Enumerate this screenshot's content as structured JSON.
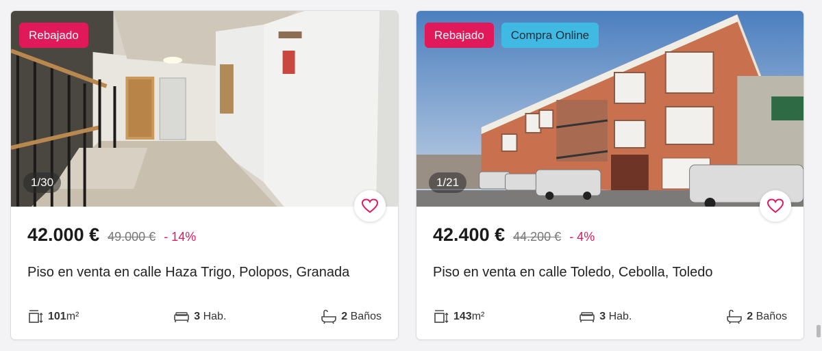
{
  "listings": [
    {
      "badges": [
        "Rebajado"
      ],
      "counter": "1/30",
      "price": "42.000 €",
      "old_price": "49.000 €",
      "discount": "- 14%",
      "title": "Piso en venta en calle Haza Trigo, Polopos, Granada",
      "area_value": "101",
      "area_unit": "m²",
      "rooms_value": "3",
      "rooms_unit": "Hab.",
      "baths_value": "2",
      "baths_unit": "Baños"
    },
    {
      "badges": [
        "Rebajado",
        "Compra Online"
      ],
      "counter": "1/21",
      "price": "42.400 €",
      "old_price": "44.200 €",
      "discount": "- 4%",
      "title": "Piso en venta en calle Toledo, Cebolla, Toledo",
      "area_value": "143",
      "area_unit": "m²",
      "rooms_value": "3",
      "rooms_unit": "Hab.",
      "baths_value": "2",
      "baths_unit": "Baños"
    }
  ],
  "colors": {
    "accent": "#e0195a",
    "online_badge": "#40b9e3"
  },
  "icons": [
    "heart-icon",
    "area-icon",
    "bed-icon",
    "bathtub-icon"
  ]
}
